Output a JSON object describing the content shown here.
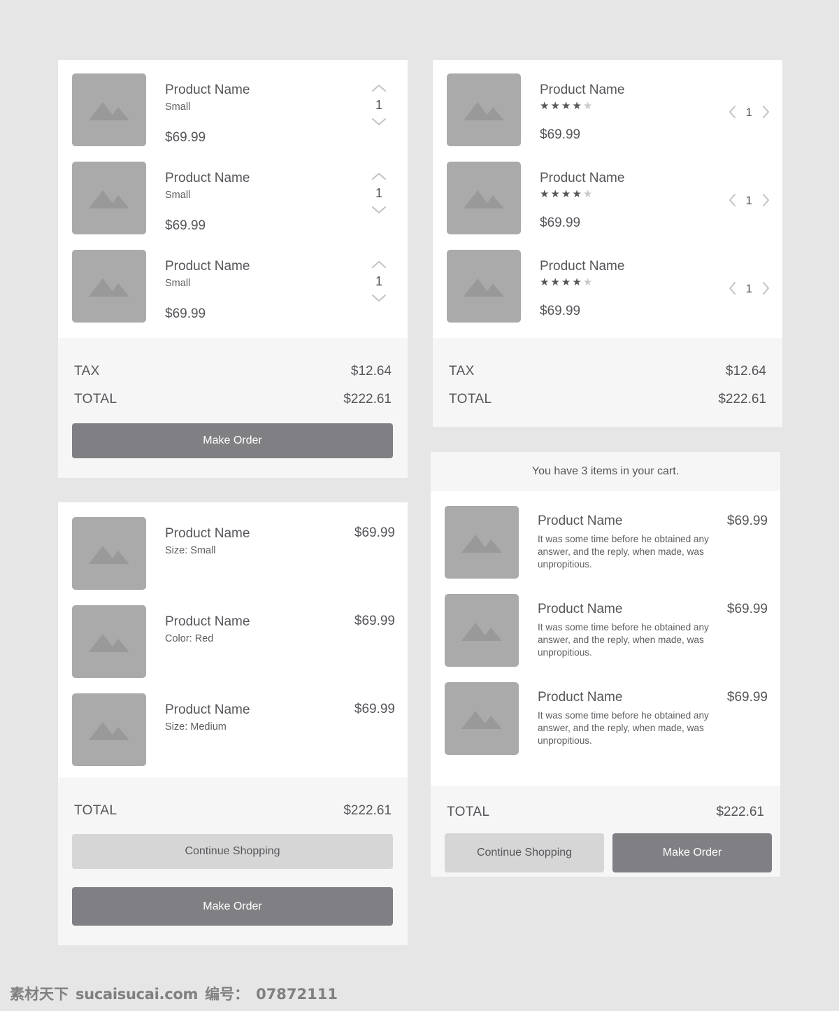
{
  "page": {
    "background": "#e6e6e6",
    "accent_primary": "#808084",
    "accent_secondary": "#d6d6d6",
    "text_color": "#55565a"
  },
  "watermark": {
    "brand": "素材天下",
    "site": "sucaisucai.com",
    "id_label": "编号：",
    "id_value": "07872111"
  },
  "cards": {
    "cart_stepper": {
      "items": [
        {
          "name": "Product Name",
          "variant": "Small",
          "price": "$69.99",
          "qty": "1"
        },
        {
          "name": "Product Name",
          "variant": "Small",
          "price": "$69.99",
          "qty": "1"
        },
        {
          "name": "Product Name",
          "variant": "Small",
          "price": "$69.99",
          "qty": "1"
        }
      ],
      "tax_label": "TAX",
      "tax_value": "$12.64",
      "total_label": "TOTAL",
      "total_value": "$222.61",
      "make_order_label": "Make Order"
    },
    "cart_rating": {
      "items": [
        {
          "name": "Product Name",
          "rating": 4,
          "max_rating": 5,
          "price": "$69.99",
          "qty": "1"
        },
        {
          "name": "Product Name",
          "rating": 4,
          "max_rating": 5,
          "price": "$69.99",
          "qty": "1"
        },
        {
          "name": "Product Name",
          "rating": 4,
          "max_rating": 5,
          "price": "$69.99",
          "qty": "1"
        }
      ],
      "tax_label": "TAX",
      "tax_value": "$12.64",
      "total_label": "TOTAL",
      "total_value": "$222.61"
    },
    "cart_variants": {
      "items": [
        {
          "name": "Product Name",
          "variant": "Size: Small",
          "price": "$69.99"
        },
        {
          "name": "Product Name",
          "variant": "Color: Red",
          "price": "$69.99"
        },
        {
          "name": "Product Name",
          "variant": "Size: Medium",
          "price": "$69.99"
        }
      ],
      "total_label": "TOTAL",
      "total_value": "$222.61",
      "continue_label": "Continue Shopping",
      "make_order_label": "Make Order"
    },
    "cart_summary": {
      "banner": "You have 3 items in your cart.",
      "items": [
        {
          "name": "Product Name",
          "price": "$69.99",
          "description": "It was some time before he obtained any answer, and the reply, when made, was unpropitious."
        },
        {
          "name": "Product Name",
          "price": "$69.99",
          "description": "It was some time before he obtained any answer, and the reply, when made, was unpropitious."
        },
        {
          "name": "Product Name",
          "price": "$69.99",
          "description": "It was some time before he obtained any answer, and the reply, when made, was unpropitious."
        }
      ],
      "total_label": "TOTAL",
      "total_value": "$222.61",
      "continue_label": "Continue Shopping",
      "make_order_label": "Make Order"
    }
  },
  "icons": {
    "image_placeholder": "image-placeholder-icon",
    "chevron_up": "chevron-up-icon",
    "chevron_down": "chevron-down-icon",
    "chevron_left": "chevron-left-icon",
    "chevron_right": "chevron-right-icon",
    "star_filled": "★",
    "star_empty": "★"
  }
}
